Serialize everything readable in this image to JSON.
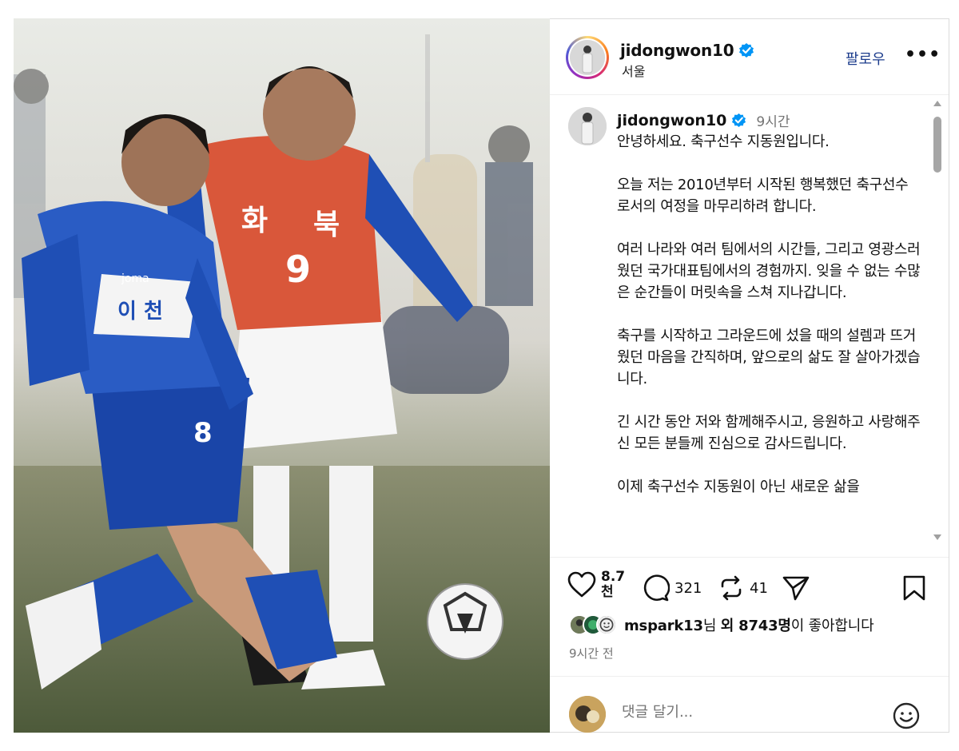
{
  "post": {
    "username": "jidongwon10",
    "location": "서울",
    "follow_label": "팔로우",
    "more_label": "•••",
    "time_short": "9시간",
    "time_long": "9시간 전",
    "caption": "안녕하세요. 축구선수 지동원입니다.\n\n오늘 저는 2010년부터 시작된 행복했던 축구선수로서의 여정을 마무리하려 합니다.\n\n여러 나라와 여러 팀에서의 시간들, 그리고 영광스러웠던 국가대표팀에서의 경험까지. 잊을 수 없는 수많은 순간들이 머릿속을 스쳐 지나갑니다.\n\n축구를 시작하고 그라운드에 섰을 때의 설렘과 뜨거웠던 마음을 간직하며, 앞으로의 삶도 잘 살아가겠습니다.\n\n긴 시간 동안 저와 함께해주시고, 응원하고 사랑해주신 모든 분들께 진심으로 감사드립니다.\n\n이제 축구선수 지동원이 아닌 새로운 삶을\n"
  },
  "actions": {
    "likes_count": "8.7천",
    "comments_count": "321",
    "reposts_count": "41"
  },
  "likers": {
    "first_user": "mspark13",
    "suffix_1": "님 ",
    "others": "외 8743명",
    "suffix_2": "이 좋아합니다"
  },
  "comment": {
    "placeholder": "댓글 달기..."
  },
  "photo": {
    "jersey_text_left": "화",
    "jersey_text_right": "북",
    "jersey_number": "9",
    "blue_jersey_text": "이 천",
    "blue_shorts_number": "8",
    "brand": "joma"
  },
  "colors": {
    "follow_blue": "#1c3c8c",
    "verified_blue": "#0095f6",
    "orange_jersey": "#d9573a",
    "blue_kit": "#1f4fb5"
  }
}
